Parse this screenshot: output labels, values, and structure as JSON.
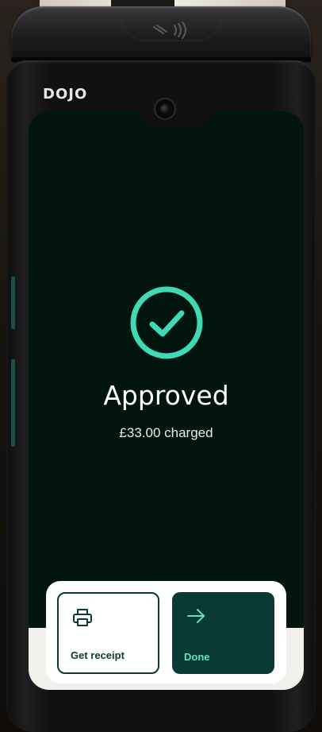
{
  "brand": {
    "logo_text": "DOJO"
  },
  "status": {
    "title": "Approved",
    "subtitle": "£33.00 charged",
    "icon": "check-circle-icon",
    "accent_color": "#3fd9b5"
  },
  "actions": {
    "receipt": {
      "label": "Get receipt",
      "icon": "printer-icon"
    },
    "done": {
      "label": "Done",
      "icon": "arrow-right-icon"
    }
  },
  "colors": {
    "screen_bg": "#03150f",
    "primary_dark": "#0b3a33",
    "done_text": "#5fe3c7"
  }
}
